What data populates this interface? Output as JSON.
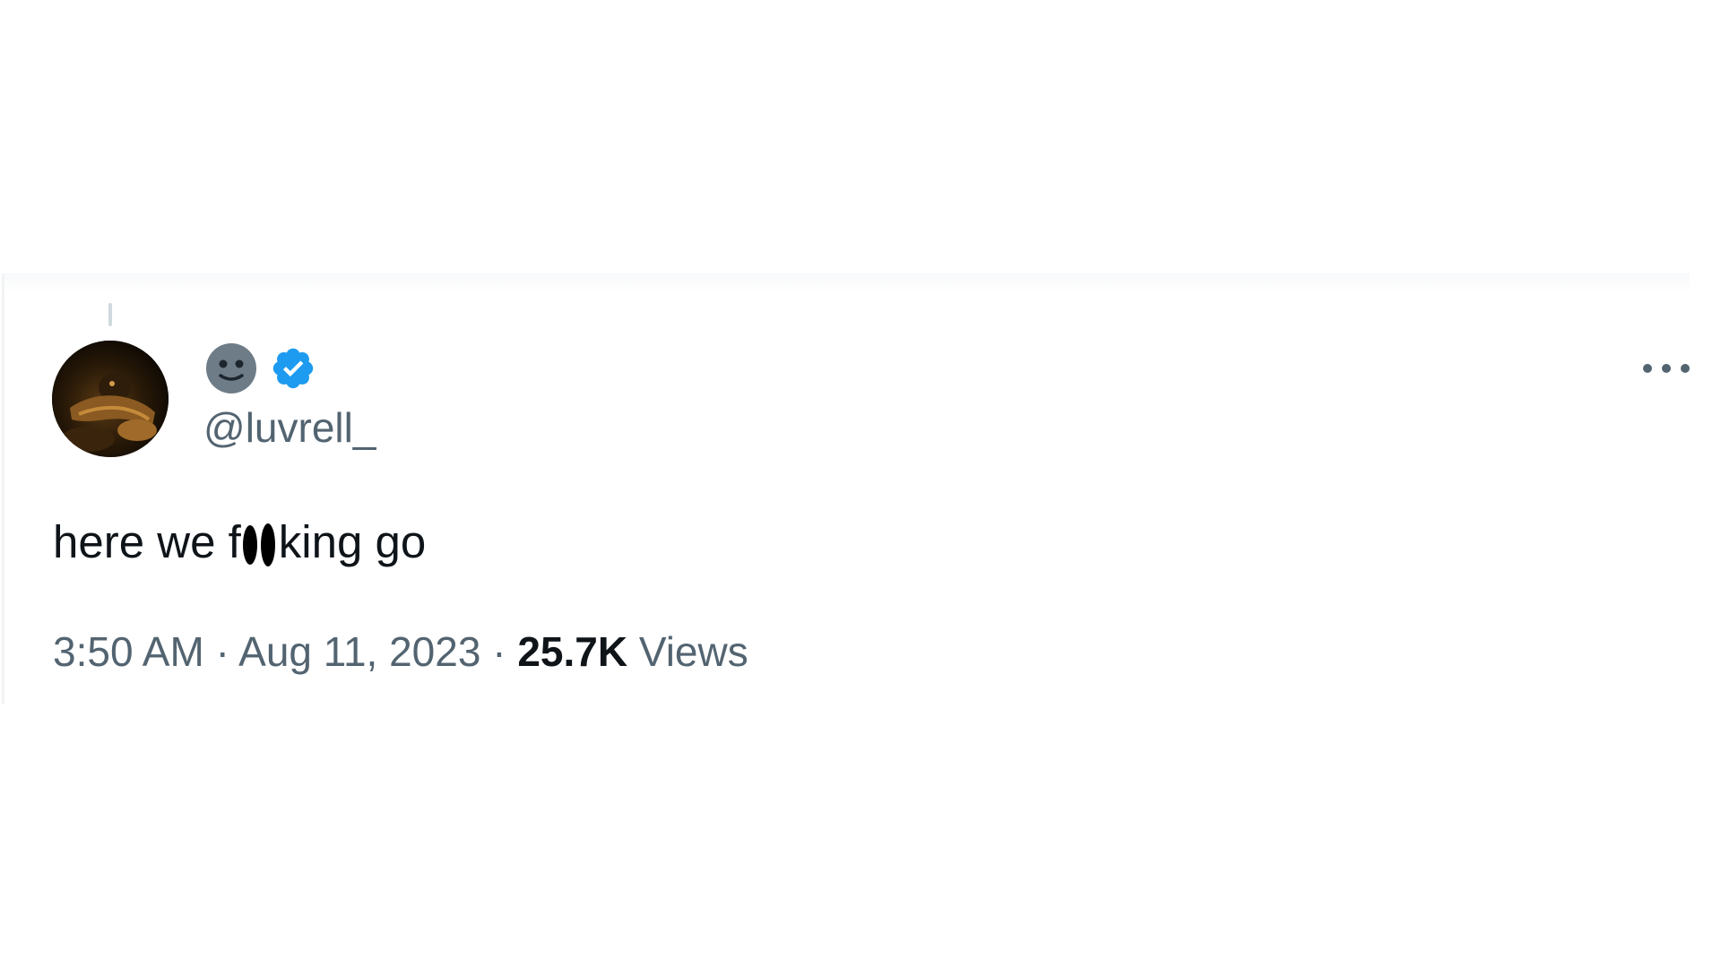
{
  "tweet": {
    "display_name_emoji": "😐",
    "verified": true,
    "handle": "@luvrell_",
    "text_before": "here we f",
    "text_after": "king go",
    "time": "3:50 AM",
    "separator": "·",
    "date": "Aug 11, 2023",
    "views_count": "25.7K",
    "views_label": "Views"
  },
  "icons": {
    "avatar": "profile-photo",
    "emoji": "neutral-face-emoji",
    "verified": "verified-badge-icon",
    "more": "more-options-icon"
  },
  "colors": {
    "text_primary": "#0f1419",
    "text_secondary": "#536471",
    "verified_blue": "#1d9bf0",
    "emoji_gray": "#6e7c87"
  }
}
